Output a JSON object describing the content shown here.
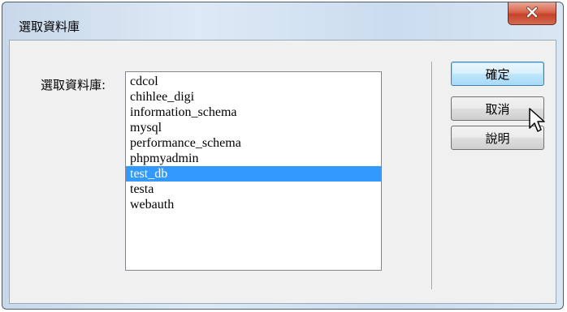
{
  "window": {
    "title": "選取資料庫"
  },
  "colors": {
    "selection": "#3399ff",
    "close_button": "#c4432a",
    "default_button_border": "#3c7fb1"
  },
  "form": {
    "label": "選取資料庫:",
    "databases": [
      "cdcol",
      "chihlee_digi",
      "information_schema",
      "mysql",
      "performance_schema",
      "phpmyadmin",
      "test_db",
      "testa",
      "webauth"
    ],
    "selected": "test_db"
  },
  "buttons": {
    "ok": "確定",
    "cancel": "取消",
    "help": "說明"
  },
  "icons": {
    "close": "close-icon",
    "cursor": "mouse-pointer-icon"
  }
}
